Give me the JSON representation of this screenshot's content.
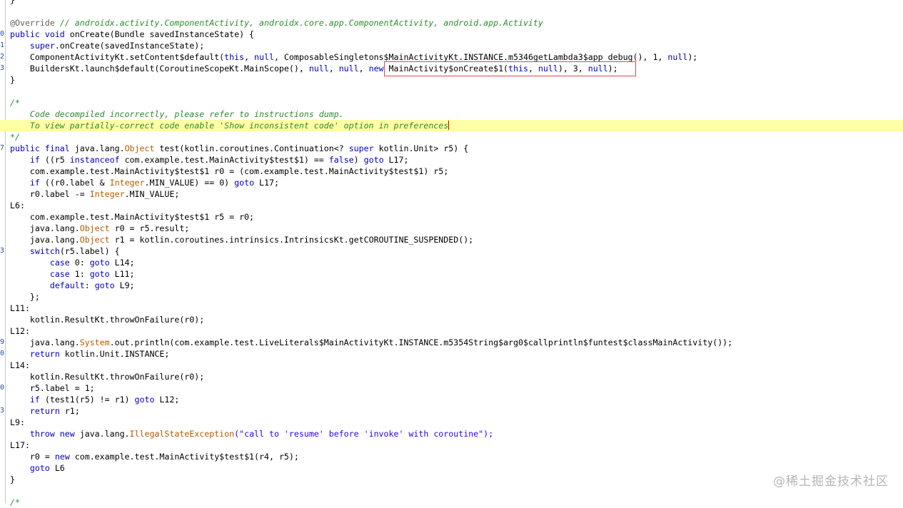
{
  "editor": {
    "lines": [
      {
        "n": "",
        "t": [
          [
            "}",
            "plain"
          ]
        ]
      },
      {
        "n": "",
        "t": []
      },
      {
        "n": "",
        "t": [
          [
            "@Override ",
            "an"
          ],
          [
            "// androidx.activity.ComponentActivity, androidx.core.app.ComponentActivity, android.app.Activity",
            "cm"
          ]
        ]
      },
      {
        "n": "0",
        "t": [
          [
            "public void ",
            "kw"
          ],
          [
            "onCreate(Bundle savedInstanceState) {",
            "plain"
          ]
        ]
      },
      {
        "n": "1",
        "t": [
          [
            "    ",
            "plain"
          ],
          [
            "super",
            "kw"
          ],
          [
            ".onCreate(savedInstanceState);",
            "plain"
          ]
        ]
      },
      {
        "n": "2",
        "t": [
          [
            "    ComponentActivityKt.setContent$default(",
            "plain"
          ],
          [
            "this",
            "kw"
          ],
          [
            ", ",
            "plain"
          ],
          [
            "null",
            "kw"
          ],
          [
            ", ComposableSingletons$MainActivityKt.INSTANCE.m5346getLambda3$app_debug(), 1, ",
            "plain"
          ],
          [
            "null",
            "kw"
          ],
          [
            ");",
            "plain"
          ]
        ]
      },
      {
        "n": "3",
        "t": [
          [
            "    BuildersKt.launch$default(CoroutineScopeKt.MainScope(), ",
            "plain"
          ],
          [
            "null",
            "kw"
          ],
          [
            ", ",
            "plain"
          ],
          [
            "null",
            "kw"
          ],
          [
            ", ",
            "plain"
          ],
          [
            "new ",
            "kw"
          ],
          [
            "MainActivity$onCreate$1(",
            "plain"
          ],
          [
            "this",
            "kw"
          ],
          [
            ", ",
            "plain"
          ],
          [
            "null",
            "kw"
          ],
          [
            "), 3, ",
            "plain"
          ],
          [
            "null",
            "kw"
          ],
          [
            ");",
            "plain"
          ]
        ]
      },
      {
        "n": "",
        "t": [
          [
            "}",
            "plain"
          ]
        ]
      },
      {
        "n": "",
        "t": []
      },
      {
        "n": "",
        "t": [
          [
            "/*",
            "cm"
          ]
        ]
      },
      {
        "n": "",
        "t": [
          [
            "    Code decompiled incorrectly, please refer to instructions dump.",
            "cm"
          ]
        ]
      },
      {
        "n": "",
        "hl": true,
        "caret": true,
        "t": [
          [
            "    To view partially-correct code enable 'Show inconsistent code' option in preferences",
            "cm"
          ]
        ]
      },
      {
        "n": "",
        "t": [
          [
            "*/",
            "cm"
          ]
        ]
      },
      {
        "n": "7",
        "t": [
          [
            "public final ",
            "kw"
          ],
          [
            "java.lang.",
            "plain"
          ],
          [
            "Object",
            "cls"
          ],
          [
            " test(kotlin.coroutines.Continuation<? ",
            "plain"
          ],
          [
            "super",
            "kw"
          ],
          [
            " kotlin.Unit> r5) {",
            "plain"
          ]
        ]
      },
      {
        "n": "",
        "t": [
          [
            "    ",
            "plain"
          ],
          [
            "if",
            "kw"
          ],
          [
            " ((r5 ",
            "plain"
          ],
          [
            "instanceof",
            "kw"
          ],
          [
            " com.example.test.MainActivity$test$1) == ",
            "plain"
          ],
          [
            "false",
            "kw"
          ],
          [
            ") ",
            "plain"
          ],
          [
            "goto",
            "kw"
          ],
          [
            " L17;",
            "plain"
          ]
        ]
      },
      {
        "n": "",
        "t": [
          [
            "    com.example.test.MainActivity$test$1 r0 = (com.example.test.MainActivity$test$1) r5;",
            "plain"
          ]
        ]
      },
      {
        "n": "",
        "t": [
          [
            "    ",
            "plain"
          ],
          [
            "if",
            "kw"
          ],
          [
            " ((r0.label & ",
            "plain"
          ],
          [
            "Integer",
            "cls"
          ],
          [
            ".MIN_VALUE) == 0) ",
            "plain"
          ],
          [
            "goto",
            "kw"
          ],
          [
            " L17;",
            "plain"
          ]
        ]
      },
      {
        "n": "",
        "t": [
          [
            "    r0.label -= ",
            "plain"
          ],
          [
            "Integer",
            "cls"
          ],
          [
            ".MIN_VALUE;",
            "plain"
          ]
        ]
      },
      {
        "n": "",
        "t": [
          [
            "L6:",
            "plain"
          ]
        ]
      },
      {
        "n": "",
        "t": [
          [
            "    com.example.test.MainActivity$test$1 r5 = r0;",
            "plain"
          ]
        ]
      },
      {
        "n": "",
        "t": [
          [
            "    java.lang.",
            "plain"
          ],
          [
            "Object",
            "cls"
          ],
          [
            " r0 = r5.result;",
            "plain"
          ]
        ]
      },
      {
        "n": "",
        "t": [
          [
            "    java.lang.",
            "plain"
          ],
          [
            "Object",
            "cls"
          ],
          [
            " r1 = kotlin.coroutines.intrinsics.IntrinsicsKt.getCOROUTINE_SUSPENDED();",
            "plain"
          ]
        ]
      },
      {
        "n": "3",
        "t": [
          [
            "    ",
            "plain"
          ],
          [
            "switch",
            "kw"
          ],
          [
            "(r5.label) {",
            "plain"
          ]
        ]
      },
      {
        "n": "",
        "t": [
          [
            "        ",
            "plain"
          ],
          [
            "case",
            "kw"
          ],
          [
            " 0: ",
            "plain"
          ],
          [
            "goto",
            "kw"
          ],
          [
            " L14;",
            "plain"
          ]
        ]
      },
      {
        "n": "",
        "t": [
          [
            "        ",
            "plain"
          ],
          [
            "case",
            "kw"
          ],
          [
            " 1: ",
            "plain"
          ],
          [
            "goto",
            "kw"
          ],
          [
            " L11;",
            "plain"
          ]
        ]
      },
      {
        "n": "",
        "t": [
          [
            "        ",
            "plain"
          ],
          [
            "default",
            "kw"
          ],
          [
            ": ",
            "plain"
          ],
          [
            "goto",
            "kw"
          ],
          [
            " L9;",
            "plain"
          ]
        ]
      },
      {
        "n": "",
        "t": [
          [
            "    };",
            "plain"
          ]
        ]
      },
      {
        "n": "",
        "t": [
          [
            "L11:",
            "plain"
          ]
        ]
      },
      {
        "n": "",
        "t": [
          [
            "    kotlin.ResultKt.throwOnFailure(r0);",
            "plain"
          ]
        ]
      },
      {
        "n": "",
        "t": [
          [
            "L12:",
            "plain"
          ]
        ]
      },
      {
        "n": "9",
        "t": [
          [
            "    java.lang.",
            "plain"
          ],
          [
            "System",
            "cls"
          ],
          [
            ".out.println(com.example.test.LiveLiterals$MainActivityKt.INSTANCE.m5354String$arg0$callprintln$funtest$classMainActivity());",
            "plain"
          ]
        ]
      },
      {
        "n": "0",
        "t": [
          [
            "    ",
            "plain"
          ],
          [
            "return",
            "kw"
          ],
          [
            " kotlin.Unit.INSTANCE;",
            "plain"
          ]
        ]
      },
      {
        "n": "",
        "t": [
          [
            "L14:",
            "plain"
          ]
        ]
      },
      {
        "n": "",
        "t": [
          [
            "    kotlin.ResultKt.throwOnFailure(r0);",
            "plain"
          ]
        ]
      },
      {
        "n": "0",
        "t": [
          [
            "    r5.label = 1;",
            "plain"
          ]
        ]
      },
      {
        "n": "",
        "t": [
          [
            "    ",
            "plain"
          ],
          [
            "if",
            "kw"
          ],
          [
            " (test1(r5) != r1) ",
            "plain"
          ],
          [
            "goto",
            "kw"
          ],
          [
            " L12;",
            "plain"
          ]
        ]
      },
      {
        "n": "3",
        "t": [
          [
            "    ",
            "plain"
          ],
          [
            "return",
            "kw"
          ],
          [
            " r1;",
            "plain"
          ]
        ]
      },
      {
        "n": "",
        "t": [
          [
            "L9:",
            "plain"
          ]
        ]
      },
      {
        "n": "",
        "t": [
          [
            "    ",
            "plain"
          ],
          [
            "throw new",
            "kw"
          ],
          [
            " java.lang.",
            "plain"
          ],
          [
            "IllegalStateException",
            "cls"
          ],
          [
            "(\"call to 'resume' before 'invoke' with coroutine\");",
            "str"
          ]
        ]
      },
      {
        "n": "",
        "t": [
          [
            "L17:",
            "plain"
          ]
        ]
      },
      {
        "n": "",
        "t": [
          [
            "    r0 = ",
            "plain"
          ],
          [
            "new",
            "kw"
          ],
          [
            " com.example.test.MainActivity$test$1(r4, r5);",
            "plain"
          ]
        ]
      },
      {
        "n": "",
        "t": [
          [
            "    ",
            "plain"
          ],
          [
            "goto",
            "kw"
          ],
          [
            " L6",
            "plain"
          ]
        ]
      },
      {
        "n": "",
        "t": [
          [
            "}",
            "plain"
          ]
        ]
      },
      {
        "n": "",
        "t": []
      },
      {
        "n": "",
        "t": [
          [
            "/*",
            "cm"
          ]
        ]
      }
    ]
  },
  "watermark": "@稀土掘金技术社区",
  "colors": {
    "highlight_line": "#ffffa6",
    "annotation_box": "#e04848",
    "keyword": "#0000c0",
    "comment": "#2e8b2e"
  }
}
